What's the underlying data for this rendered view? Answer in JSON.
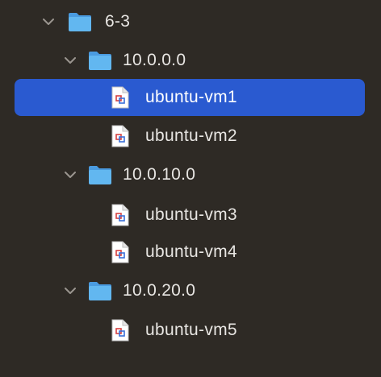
{
  "tree": {
    "root": {
      "label": "6-3",
      "expanded": true,
      "icon": "folder-icon",
      "children": [
        {
          "label": "10.0.0.0",
          "expanded": true,
          "icon": "folder-icon",
          "children": [
            {
              "label": "ubuntu-vm1",
              "icon": "vm-file-icon",
              "selected": true
            },
            {
              "label": "ubuntu-vm2",
              "icon": "vm-file-icon",
              "selected": false
            }
          ]
        },
        {
          "label": "10.0.10.0",
          "expanded": true,
          "icon": "folder-icon",
          "children": [
            {
              "label": "ubuntu-vm3",
              "icon": "vm-file-icon",
              "selected": false
            },
            {
              "label": "ubuntu-vm4",
              "icon": "vm-file-icon",
              "selected": false
            }
          ]
        },
        {
          "label": "10.0.20.0",
          "expanded": true,
          "icon": "folder-icon",
          "children": [
            {
              "label": "ubuntu-vm5",
              "icon": "vm-file-icon",
              "selected": false
            }
          ]
        }
      ]
    }
  },
  "colors": {
    "background": "#2e2a25",
    "selection": "#2a5ad0",
    "folder": "#5fb4ee",
    "text": "#e8e6e3"
  }
}
